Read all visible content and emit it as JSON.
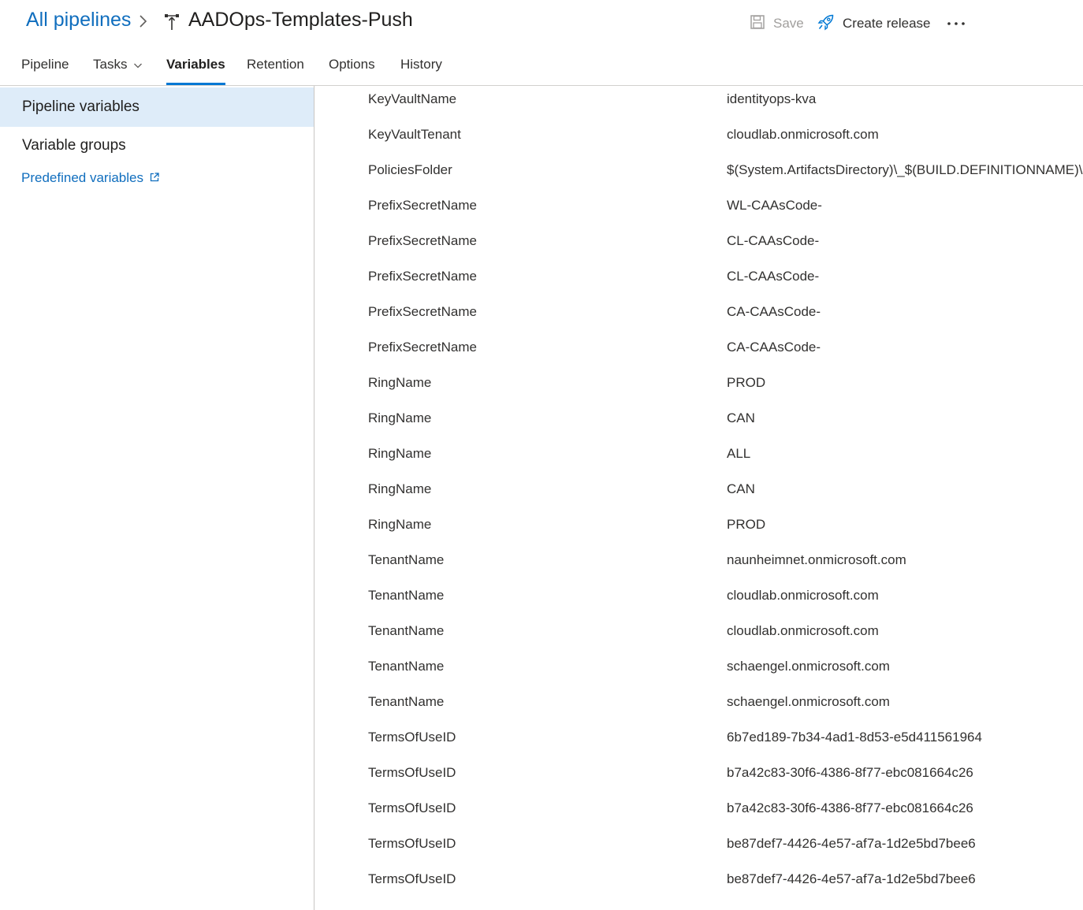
{
  "header": {
    "breadcrumb_root": "All pipelines",
    "pipeline_name": "AADOps-Templates-Push",
    "save_label": "Save",
    "create_release_label": "Create release",
    "more_label": "···"
  },
  "tabs": [
    {
      "label": "Pipeline"
    },
    {
      "label": "Tasks"
    },
    {
      "label": "Variables"
    },
    {
      "label": "Retention"
    },
    {
      "label": "Options"
    },
    {
      "label": "History"
    }
  ],
  "active_tab": "Variables",
  "sidebar": {
    "items": [
      {
        "label": "Pipeline variables"
      },
      {
        "label": "Variable groups"
      }
    ],
    "link_label": "Predefined variables"
  },
  "variables": [
    {
      "name": "KeyVaultName",
      "value": "identityops-kva"
    },
    {
      "name": "KeyVaultTenant",
      "value": "cloudlab.onmicrosoft.com"
    },
    {
      "name": "PoliciesFolder",
      "value": "$(System.ArtifactsDirectory)\\_$(BUILD.DEFINITIONNAME)\\J"
    },
    {
      "name": "PrefixSecretName",
      "value": "WL-CAAsCode-"
    },
    {
      "name": "PrefixSecretName",
      "value": "CL-CAAsCode-"
    },
    {
      "name": "PrefixSecretName",
      "value": "CL-CAAsCode-"
    },
    {
      "name": "PrefixSecretName",
      "value": "CA-CAAsCode-"
    },
    {
      "name": "PrefixSecretName",
      "value": "CA-CAAsCode-"
    },
    {
      "name": "RingName",
      "value": "PROD"
    },
    {
      "name": "RingName",
      "value": "CAN"
    },
    {
      "name": "RingName",
      "value": "ALL"
    },
    {
      "name": "RingName",
      "value": "CAN"
    },
    {
      "name": "RingName",
      "value": "PROD"
    },
    {
      "name": "TenantName",
      "value": "naunheimnet.onmicrosoft.com"
    },
    {
      "name": "TenantName",
      "value": "cloudlab.onmicrosoft.com"
    },
    {
      "name": "TenantName",
      "value": "cloudlab.onmicrosoft.com"
    },
    {
      "name": "TenantName",
      "value": "schaengel.onmicrosoft.com"
    },
    {
      "name": "TenantName",
      "value": "schaengel.onmicrosoft.com"
    },
    {
      "name": "TermsOfUseID",
      "value": "6b7ed189-7b34-4ad1-8d53-e5d411561964"
    },
    {
      "name": "TermsOfUseID",
      "value": "b7a42c83-30f6-4386-8f77-ebc081664c26"
    },
    {
      "name": "TermsOfUseID",
      "value": "b7a42c83-30f6-4386-8f77-ebc081664c26"
    },
    {
      "name": "TermsOfUseID",
      "value": "be87def7-4426-4e57-af7a-1d2e5bd7bee6"
    },
    {
      "name": "TermsOfUseID",
      "value": "be87def7-4426-4e57-af7a-1d2e5bd7bee6"
    }
  ],
  "icons": {
    "breadcrumb_separator": "chevron-right-icon",
    "pipeline": "release-pipeline-icon",
    "save": "save-icon",
    "create_release": "rocket-icon",
    "tasks_dropdown": "chevron-down-icon",
    "external_link": "external-link-icon"
  },
  "colors": {
    "accent": "#0078d4",
    "link": "#106ebe",
    "selected_bg": "#deecf9",
    "text": "#323130",
    "disabled": "#a19f9d"
  }
}
